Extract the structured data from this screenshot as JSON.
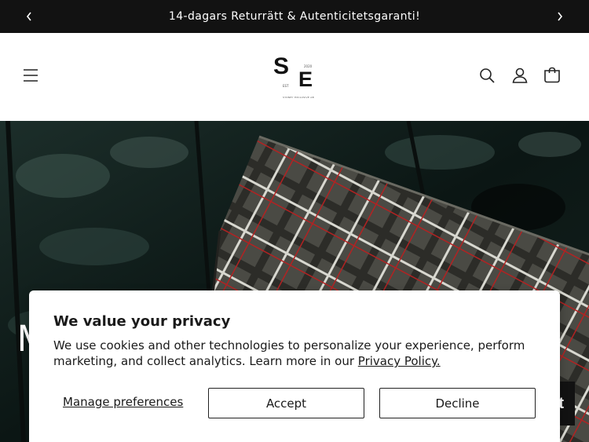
{
  "announcement": {
    "text": "14-dagars Returrätt & Autenticitetsgaranti!"
  },
  "header": {
    "logo": {
      "letter_1": "S",
      "letter_2": "E",
      "est": "EST",
      "year": "2020",
      "tagline": "SYDNEY EXCLUSIVE AB"
    },
    "icons": [
      "menu-icon",
      "search-icon",
      "account-icon",
      "cart-icon"
    ]
  },
  "hero": {
    "heading": "M                                              A",
    "cta_fragment": "t"
  },
  "cookie_banner": {
    "title": "We value your privacy",
    "text_before_link": "We use cookies and other technologies to personalize your experience, perform marketing, and collect analytics. Learn more in our ",
    "link_text": "Privacy Policy.",
    "manage_label": "Manage preferences",
    "accept_label": "Accept",
    "decline_label": "Decline"
  },
  "colors": {
    "announcement_bg": "#121212",
    "hero_jacket": "#0f1d1a",
    "scarf_plaid": "#5a5a52",
    "plaid_red": "#a02020"
  }
}
